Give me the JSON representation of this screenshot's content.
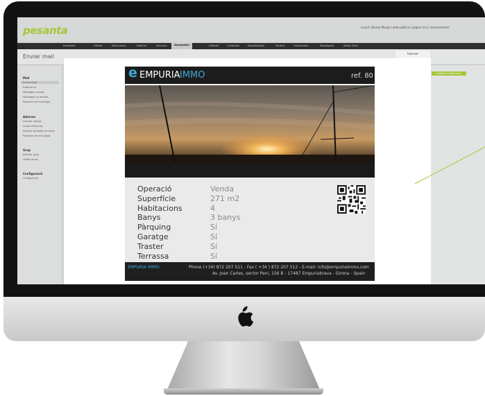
{
  "app": {
    "logo": "pesanta",
    "user_bar": "usuari: Bernat Morgó   |   web pública   |   pàgina inici   |   desconnectar"
  },
  "nav": {
    "items": [
      "Immobles",
      "Clients",
      "Documents",
      "Notícies",
      "Seccions",
      "Newsletter",
      "Utilitats",
      "Contactes",
      "Estadístiques",
      "Usuaris",
      "Traduccions",
      "Missatgeria",
      "Admin total"
    ],
    "active_index": 5
  },
  "page": {
    "title": "Enviar mail",
    "close_label": "tancar",
    "right_button": "Guardar a Esborranys"
  },
  "sidebar": {
    "groups": [
      {
        "title": "Mail",
        "items": [
          "Enviar mail",
          "Esborranys",
          "Missatges enviats",
          "Missatges no enviats",
          "Paperera de reciclatge"
        ]
      },
      {
        "title": "Adreces",
        "items": [
          "Insertar adreça",
          "Llistat d'adreces",
          "Adreces donades de baixa",
          "Paperera de reciclatge"
        ]
      },
      {
        "title": "Grup",
        "items": [
          "Insertar grup",
          "Llistar grups"
        ]
      },
      {
        "title": "Configuració",
        "items": [
          "Configuració"
        ]
      }
    ],
    "selected": "Enviar mail"
  },
  "newsletter": {
    "brand_part1": "EMPURIA",
    "brand_part2": "IMMO",
    "ref": "ref. 80",
    "details": [
      {
        "label": "Operació",
        "value": "Venda"
      },
      {
        "label": "Superfície",
        "value": "271 m2"
      },
      {
        "label": "Habitacions",
        "value": "4"
      },
      {
        "label": "Banys",
        "value": "3 banys"
      },
      {
        "label": "Pàrquing",
        "value": "Sí"
      },
      {
        "label": "Garatge",
        "value": "Sí"
      },
      {
        "label": "Traster",
        "value": "Sí"
      },
      {
        "label": "Terrassa",
        "value": "Sí"
      }
    ],
    "footer_brand": "EMPURIA IMMO",
    "footer_line1": "Phone (+34) 872 207 511 - Fax ( +34 ) 872 207 512 - E-mail: info@empuriaimmo.com",
    "footer_line2": "Av. Joan Carles, sector Peni, 156 B - 17487 Empuriabrava - Girona - Spain"
  },
  "colors": {
    "accent_green": "#a6c63a",
    "brand_blue": "#3fa9d8",
    "bezel": "#121212"
  }
}
